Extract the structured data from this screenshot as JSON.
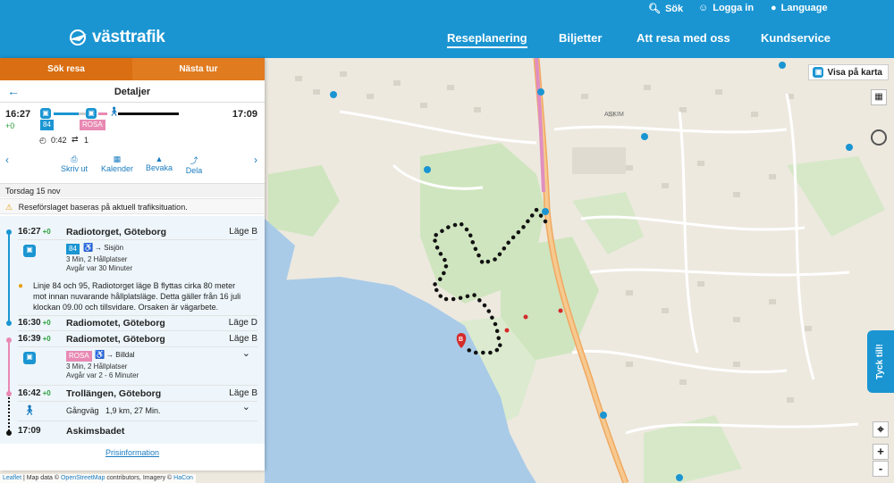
{
  "topbar": {
    "search_label": "Sök",
    "login_label": "Logga in",
    "language_label": "Language"
  },
  "brand": {
    "name": "västtrafik"
  },
  "nav": {
    "items": [
      {
        "label": "Reseplanering",
        "active": true
      },
      {
        "label": "Biljetter",
        "active": false
      },
      {
        "label": "Att resa med oss",
        "active": false
      },
      {
        "label": "Kundservice",
        "active": false
      }
    ]
  },
  "panel": {
    "tabs": [
      {
        "label": "Sök resa"
      },
      {
        "label": "Nästa tur"
      }
    ],
    "header_title": "Detaljer",
    "summary": {
      "depart": "16:27",
      "delay": "+0",
      "arrive": "17:09",
      "line1": "84",
      "line2": "ROSA",
      "duration": "0:42",
      "changes": "1"
    },
    "actions": [
      {
        "label": "Skriv ut",
        "icon": "print-icon"
      },
      {
        "label": "Kalender",
        "icon": "calendar-icon"
      },
      {
        "label": "Bevaka",
        "icon": "bell-icon"
      },
      {
        "label": "Dela",
        "icon": "share-icon"
      }
    ],
    "date": "Torsdag 15 nov",
    "warning": "Reseförslaget baseras på aktuell trafiksituation.",
    "legs": {
      "stop1": {
        "time": "16:27",
        "delay": "+0",
        "name": "Radiotorget, Göteborg",
        "lage": "Läge B"
      },
      "bus1": {
        "line": "84",
        "direction": "Sisjön",
        "info1": "3 Min, 2 Hållplatser",
        "info2": "Avgår var 30 Minuter"
      },
      "notice": "Linje 84 och 95, Radiotorget läge B flyttas cirka 80 meter mot innan nuvarande hållplatsläge. Detta gäller från 16 juli klockan 09.00 och tillsvidare. Orsaken är vägarbete.",
      "stop2": {
        "time": "16:30",
        "delay": "+0",
        "name": "Radiomotet, Göteborg",
        "lage": "Läge D"
      },
      "stop3": {
        "time": "16:39",
        "delay": "+0",
        "name": "Radiomotet, Göteborg",
        "lage": "Läge B"
      },
      "bus2": {
        "line": "ROSA",
        "direction": "Billdal",
        "info1": "3 Min, 2 Hållplatser",
        "info2": "Avgår var 2 - 6 Minuter"
      },
      "stop4": {
        "time": "16:42",
        "delay": "+0",
        "name": "Trollängen, Göteborg",
        "lage": "Läge B"
      },
      "walk": {
        "label": "Gångväg",
        "detail": "1,9 km, 27 Min."
      },
      "stop5": {
        "time": "17:09",
        "name": "Askimsbadet"
      }
    },
    "footer_link": "Prisinformation"
  },
  "map": {
    "show_on_map": "Visa på karta",
    "feedback": "Tyck till!",
    "zoom_in": "+",
    "zoom_out": "-",
    "marker_label": "B",
    "place_label": "ASKIM",
    "attribution": {
      "leaflet": "Leaflet",
      "text1": " | Map data © ",
      "osm": "OpenStreetMap",
      "text2": " contributors, Imagery © ",
      "hacon": "HaCon"
    }
  },
  "colors": {
    "brand_blue": "#1a95d2",
    "tab_orange": "#e07b1f",
    "line84": "#1a95d2",
    "rosa": "#e889b3",
    "water": "#a9cbe8",
    "park": "#cfe5bf"
  }
}
